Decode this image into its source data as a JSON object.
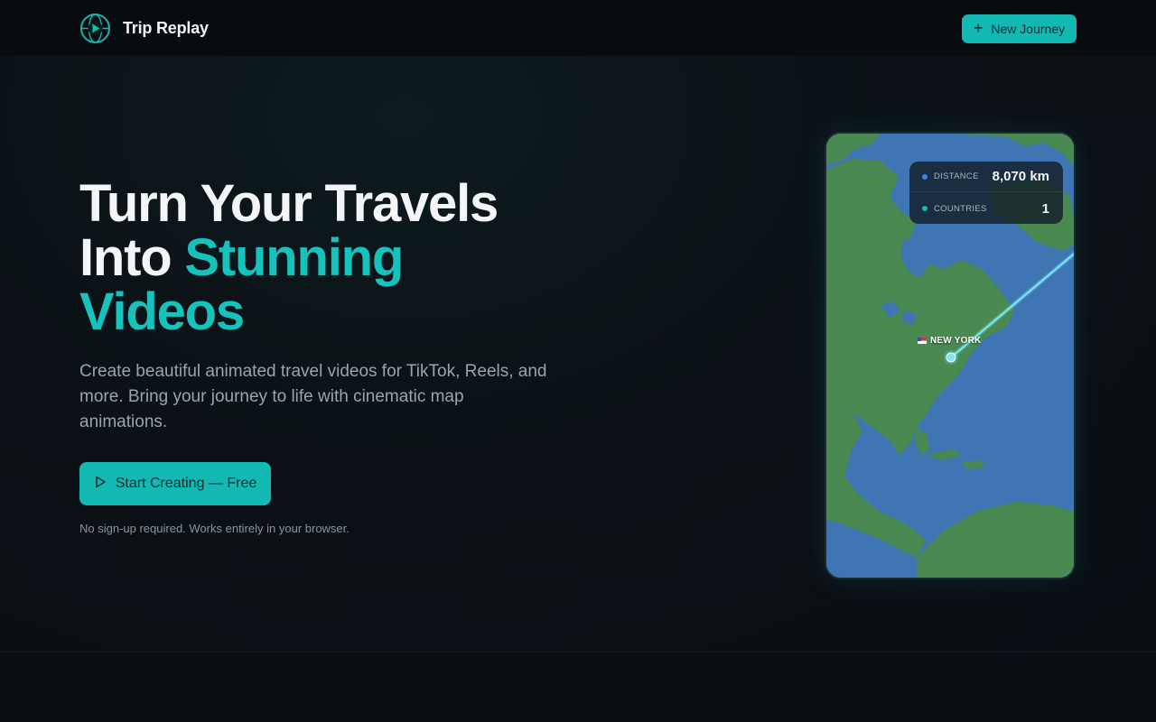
{
  "header": {
    "brand_name": "Trip Replay",
    "new_journey_label": "New Journey"
  },
  "hero": {
    "title_line1": "Turn Your Travels",
    "title_line2_plain": "Into ",
    "title_line2_accent": "Stunning",
    "title_line3_accent": "Videos",
    "subtitle": "Create beautiful animated travel videos for TikTok, Reels, and more. Bring your journey to life with cinematic map animations.",
    "cta_label": "Start Creating — Free",
    "cta_note": "No sign-up required. Works entirely in your browser."
  },
  "preview": {
    "stats": [
      {
        "label": "DISTANCE",
        "value": "8,070 km",
        "dot_color": "#3b82f6"
      },
      {
        "label": "COUNTRIES",
        "value": "1",
        "dot_color": "#14b8a6"
      }
    ],
    "city_label": "NEW YORK"
  },
  "icons": {
    "brand": "play-globe-icon",
    "new_journey": "plus-icon",
    "cta": "play-icon",
    "city": "us-flag-icon"
  },
  "colors": {
    "accent": "#14b8b3",
    "accent_text": "#16c2bc",
    "background": "#0b0f14",
    "ocean": "#3f75b3",
    "land": "#4a8a52",
    "route": "#5ff3ff"
  }
}
